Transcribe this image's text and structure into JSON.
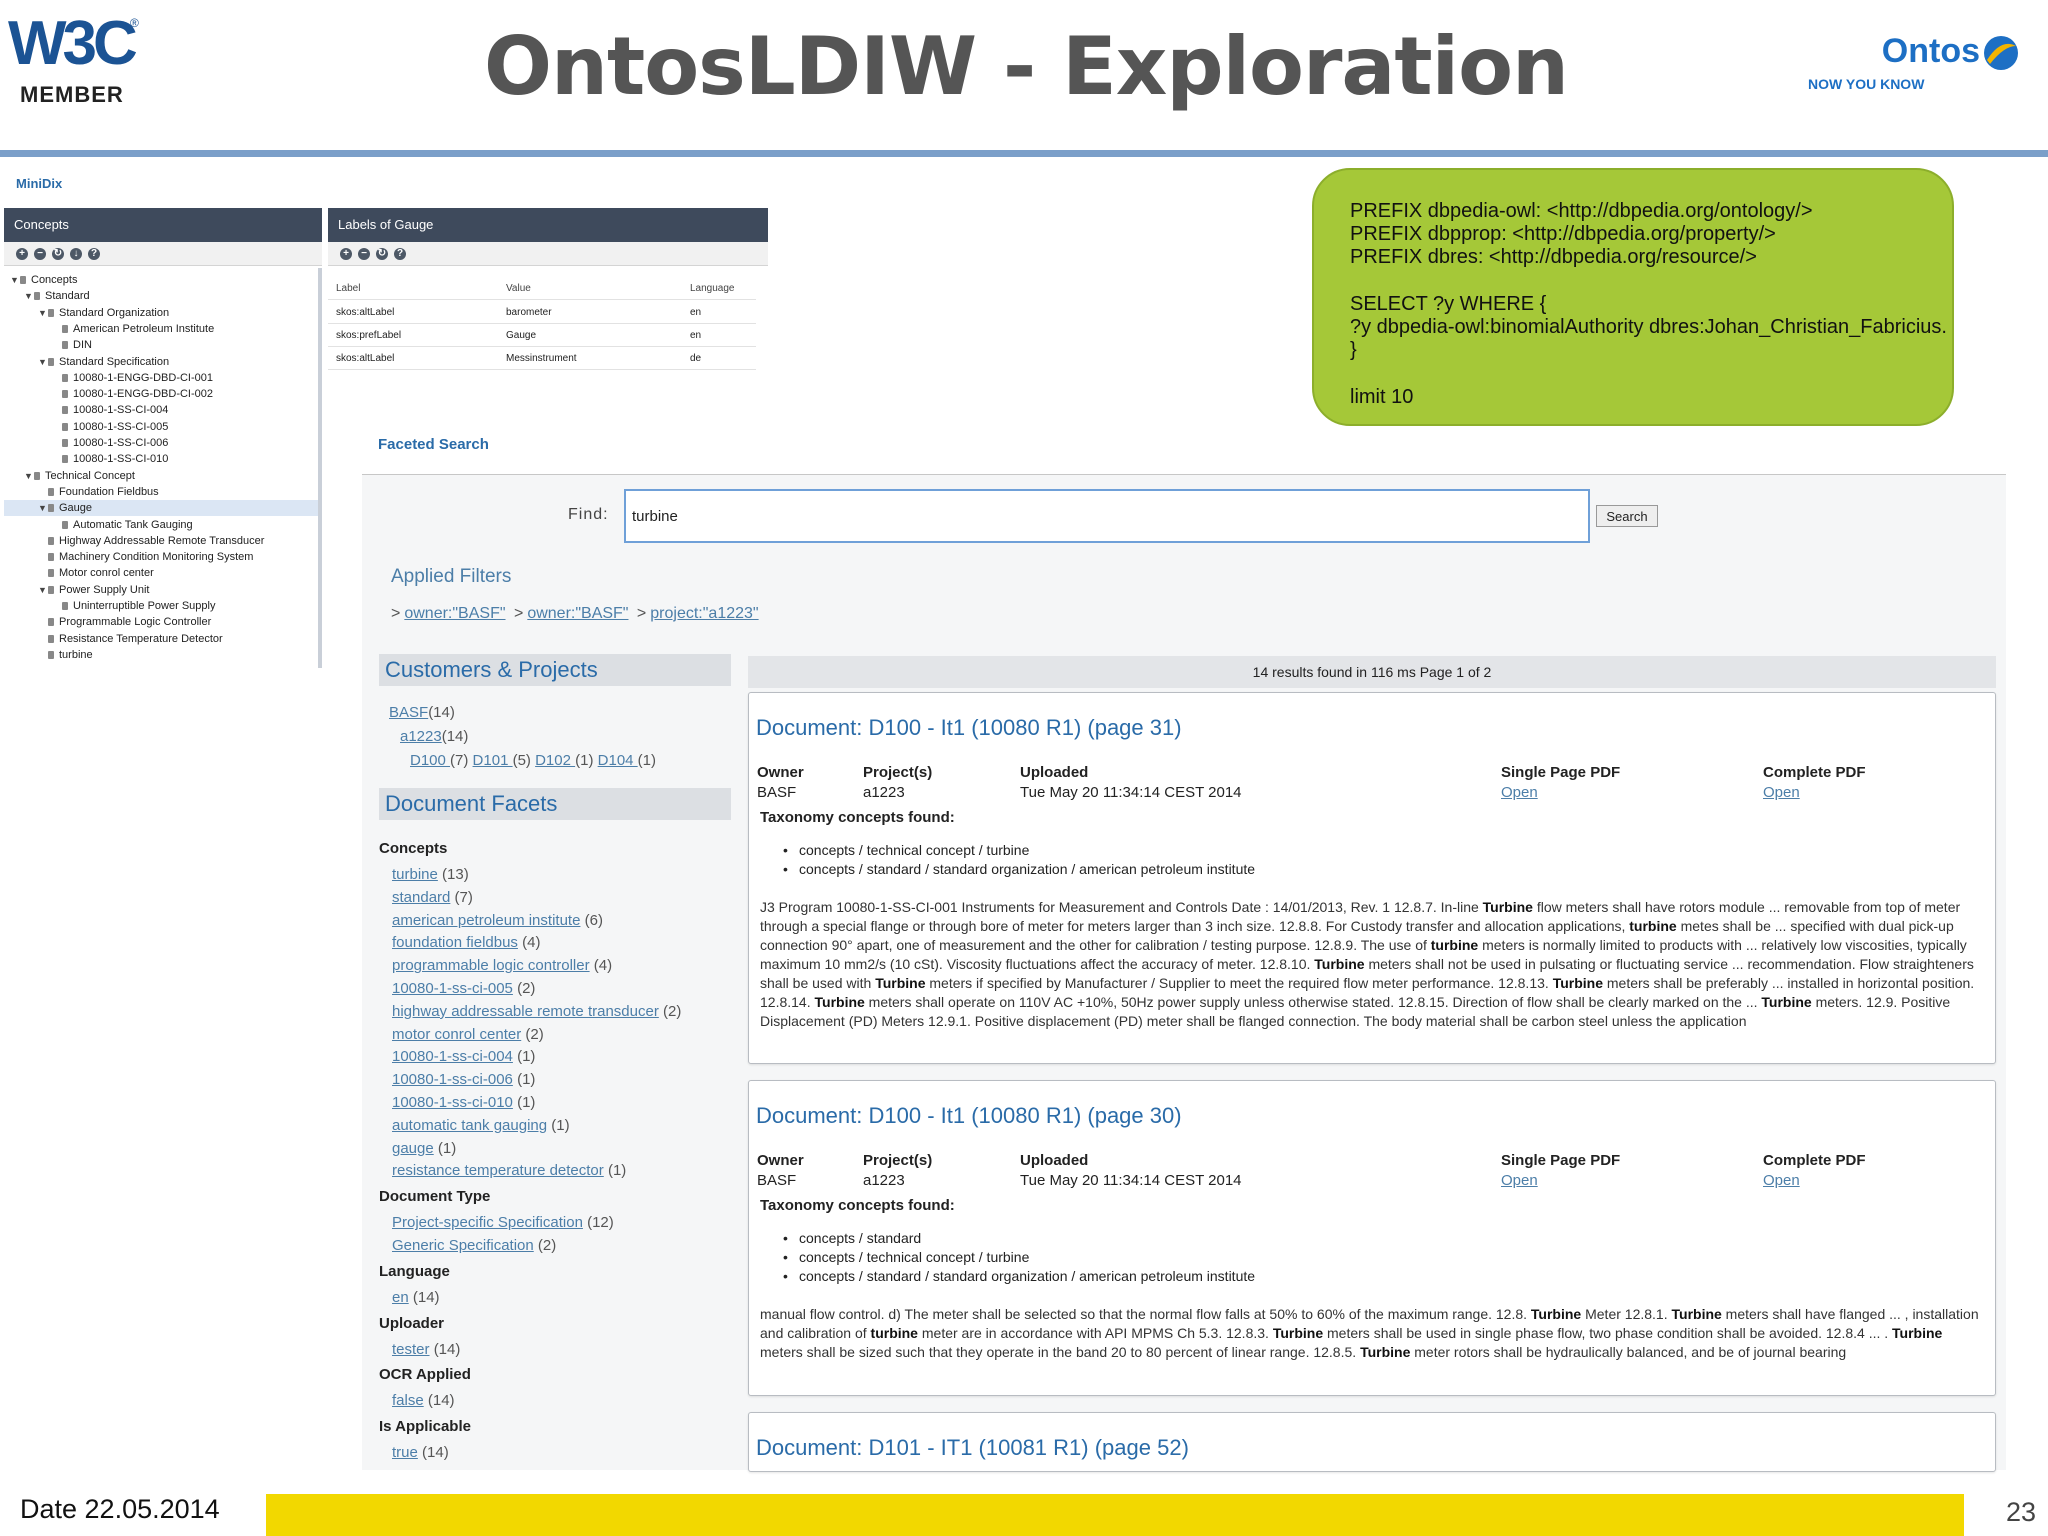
{
  "header": {
    "w3c_logo": "W3C",
    "w3c_member": "MEMBER",
    "title": "OntosLDIW - Exploration",
    "brand": "Ontos",
    "brand_tagline": "NOW YOU KNOW",
    "rule_color": "#7b9fc9"
  },
  "minidix": {
    "app_title": "MiniDix",
    "concepts_panel": {
      "title": "Concepts",
      "tools": [
        "add-icon",
        "remove-icon",
        "refresh-icon",
        "download-icon",
        "help-icon"
      ],
      "tree": [
        {
          "label": "Concepts",
          "level": 0,
          "toggle": "▼"
        },
        {
          "label": "Standard",
          "level": 1,
          "toggle": "▼"
        },
        {
          "label": "Standard Organization",
          "level": 2,
          "toggle": "▼"
        },
        {
          "label": "American Petroleum Institute",
          "level": 3,
          "toggle": ""
        },
        {
          "label": "DIN",
          "level": 3,
          "toggle": ""
        },
        {
          "label": "Standard Specification",
          "level": 2,
          "toggle": "▼"
        },
        {
          "label": "10080-1-ENGG-DBD-CI-001",
          "level": 3,
          "toggle": ""
        },
        {
          "label": "10080-1-ENGG-DBD-CI-002",
          "level": 3,
          "toggle": ""
        },
        {
          "label": "10080-1-SS-CI-004",
          "level": 3,
          "toggle": ""
        },
        {
          "label": "10080-1-SS-CI-005",
          "level": 3,
          "toggle": ""
        },
        {
          "label": "10080-1-SS-CI-006",
          "level": 3,
          "toggle": ""
        },
        {
          "label": "10080-1-SS-CI-010",
          "level": 3,
          "toggle": ""
        },
        {
          "label": "Technical Concept",
          "level": 1,
          "toggle": "▼"
        },
        {
          "label": "Foundation Fieldbus",
          "level": 2,
          "toggle": ""
        },
        {
          "label": "Gauge",
          "level": 2,
          "toggle": "▼",
          "selected": true
        },
        {
          "label": "Automatic Tank Gauging",
          "level": 3,
          "toggle": ""
        },
        {
          "label": "Highway Addressable Remote Transducer",
          "level": 2,
          "toggle": ""
        },
        {
          "label": "Machinery Condition Monitoring System",
          "level": 2,
          "toggle": ""
        },
        {
          "label": "Motor conrol center",
          "level": 2,
          "toggle": ""
        },
        {
          "label": "Power Supply Unit",
          "level": 2,
          "toggle": "▼"
        },
        {
          "label": "Uninterruptible Power Supply",
          "level": 3,
          "toggle": ""
        },
        {
          "label": "Programmable Logic Controller",
          "level": 2,
          "toggle": ""
        },
        {
          "label": "Resistance Temperature Detector",
          "level": 2,
          "toggle": ""
        },
        {
          "label": "turbine",
          "level": 2,
          "toggle": ""
        }
      ]
    },
    "labels_panel": {
      "title": "Labels of Gauge",
      "tools": [
        "add-icon",
        "remove-icon",
        "refresh-icon",
        "help-icon"
      ],
      "columns": [
        "Label",
        "Value",
        "Language"
      ],
      "rows": [
        [
          "skos:altLabel",
          "barometer",
          "en"
        ],
        [
          "skos:prefLabel",
          "Gauge",
          "en"
        ],
        [
          "skos:altLabel",
          "Messinstrument",
          "de"
        ]
      ]
    }
  },
  "sparql": {
    "lines": [
      "PREFIX dbpedia-owl: <http://dbpedia.org/ontology/>",
      "PREFIX dbpprop: <http://dbpedia.org/property/>",
      "PREFIX dbres: <http://dbpedia.org/resource/>",
      "",
      "SELECT ?y WHERE {",
      " ?y dbpedia-owl:binomialAuthority dbres:Johan_Christian_Fabricius.",
      " }",
      "",
      "limit 10"
    ],
    "color": "#a5c838"
  },
  "faceted_search": {
    "title": "Faceted Search",
    "find_label": "Find:",
    "query": "turbine",
    "search_button": "Search",
    "applied_filters_title": "Applied Filters",
    "filters": [
      "owner:\"BASF\"",
      "owner:\"BASF\"",
      "project:\"a1223\""
    ],
    "customers_projects": {
      "title": "Customers & Projects",
      "customer": {
        "name": "BASF",
        "count": "(14)"
      },
      "project": {
        "name": "a1223",
        "count": "(14)"
      },
      "documents": [
        {
          "name": "D100 ",
          "count": "(7)"
        },
        {
          "name": "D101 ",
          "count": "(5)"
        },
        {
          "name": "D102 ",
          "count": "(1)"
        },
        {
          "name": "D104 ",
          "count": "(1)"
        }
      ]
    },
    "document_facets": {
      "title": "Document Facets",
      "groups": [
        {
          "name": "Concepts",
          "items": [
            {
              "label": "turbine",
              "count": "(13)"
            },
            {
              "label": "standard",
              "count": "(7)"
            },
            {
              "label": "american petroleum institute",
              "count": "(6)"
            },
            {
              "label": "foundation fieldbus",
              "count": "(4)"
            },
            {
              "label": "programmable logic controller",
              "count": "(4)"
            },
            {
              "label": "10080-1-ss-ci-005",
              "count": "(2)"
            },
            {
              "label": "highway addressable remote transducer",
              "count": "(2)"
            },
            {
              "label": "motor conrol center",
              "count": "(2)"
            },
            {
              "label": "10080-1-ss-ci-004",
              "count": "(1)"
            },
            {
              "label": "10080-1-ss-ci-006",
              "count": "(1)"
            },
            {
              "label": "10080-1-ss-ci-010",
              "count": "(1)"
            },
            {
              "label": "automatic tank gauging",
              "count": "(1)"
            },
            {
              "label": "gauge",
              "count": "(1)"
            },
            {
              "label": "resistance temperature detector",
              "count": "(1)"
            }
          ]
        },
        {
          "name": "Document Type",
          "items": [
            {
              "label": "Project-specific Specification",
              "count": "(12)"
            },
            {
              "label": "Generic Specification",
              "count": "(2)"
            }
          ]
        },
        {
          "name": "Language",
          "items": [
            {
              "label": "en",
              "count": "(14)"
            }
          ]
        },
        {
          "name": "Uploader",
          "items": [
            {
              "label": "tester",
              "count": "(14)"
            }
          ]
        },
        {
          "name": "OCR Applied",
          "items": [
            {
              "label": "false",
              "count": "(14)"
            }
          ]
        },
        {
          "name": "Is Applicable",
          "items": [
            {
              "label": "true",
              "count": "(14)"
            }
          ]
        }
      ]
    },
    "results_summary": "14 results found in 116 ms Page 1 of 2",
    "meta_labels": {
      "owner": "Owner",
      "projects": "Project(s)",
      "uploaded": "Uploaded",
      "single_pdf": "Single Page PDF",
      "complete_pdf": "Complete PDF",
      "open": "Open",
      "taxonomy": "Taxonomy concepts found:"
    },
    "results": [
      {
        "title": "Document: D100 - It1 (10080 R1) (page 31)",
        "owner": "BASF",
        "project": "a1223",
        "uploaded": "Tue May 20 11:34:14 CEST 2014",
        "concepts": [
          "concepts / technical concept / turbine",
          "concepts / standard / standard organization / american petroleum institute"
        ],
        "snippet": [
          {
            "t": "J3 Program 10080-1-SS-CI-001 Instruments for Measurement and Controls Date : 14/01/2013, Rev. 1 12.8.7. In-line "
          },
          {
            "t": "Turbine",
            "b": true
          },
          {
            "t": " flow meters shall have rotors module ... removable from top of meter through a special flange or through bore of meter for meters larger than 3 inch size. 12.8.8. For Custody transfer and allocation applications, "
          },
          {
            "t": "turbine",
            "b": true
          },
          {
            "t": " metes shall be ... specified with dual pick-up connection 90° apart, one of measurement and the other for calibration / testing purpose. 12.8.9. The use of "
          },
          {
            "t": "turbine",
            "b": true
          },
          {
            "t": " meters is normally limited to products with ... relatively low viscosities, typically maximum 10 mm2/s (10 cSt). Viscosity fluctuations affect the accuracy of meter. 12.8.10. "
          },
          {
            "t": "Turbine",
            "b": true
          },
          {
            "t": " meters shall not be used in pulsating or fluctuating service ... recommendation. Flow straighteners shall be used with "
          },
          {
            "t": "Turbine",
            "b": true
          },
          {
            "t": " meters if specified by Manufacturer / Supplier to meet the required flow meter performance. 12.8.13. "
          },
          {
            "t": "Turbine",
            "b": true
          },
          {
            "t": " meters shall be preferably ... installed in horizontal position. 12.8.14. "
          },
          {
            "t": "Turbine",
            "b": true
          },
          {
            "t": " meters shall operate on 110V AC +10%, 50Hz power supply unless otherwise stated. 12.8.15. Direction of flow shall be clearly marked on the ... "
          },
          {
            "t": "Turbine",
            "b": true
          },
          {
            "t": " meters. 12.9. Positive Displacement (PD) Meters 12.9.1. Positive displacement (PD) meter shall be flanged connection. The body material shall be carbon steel unless the application"
          }
        ]
      },
      {
        "title": "Document: D100 - It1 (10080 R1) (page 30)",
        "owner": "BASF",
        "project": "a1223",
        "uploaded": "Tue May 20 11:34:14 CEST 2014",
        "concepts": [
          "concepts / standard",
          "concepts / technical concept / turbine",
          "concepts / standard / standard organization / american petroleum institute"
        ],
        "snippet": [
          {
            "t": "manual flow control. d) The meter shall be selected so that the normal flow falls at 50% to 60% of the maximum range. 12.8. "
          },
          {
            "t": "Turbine",
            "b": true
          },
          {
            "t": " Meter 12.8.1. "
          },
          {
            "t": "Turbine",
            "b": true
          },
          {
            "t": " meters shall have flanged ... , installation and calibration of "
          },
          {
            "t": "turbine",
            "b": true
          },
          {
            "t": " meter are in accordance with API MPMS Ch 5.3. 12.8.3. "
          },
          {
            "t": "Turbine",
            "b": true
          },
          {
            "t": " meters shall be used in single phase flow, two phase condition shall be avoided. 12.8.4 ... . "
          },
          {
            "t": "Turbine",
            "b": true
          },
          {
            "t": " meters shall be sized such that they operate in the band 20 to 80 percent of linear range. 12.8.5. "
          },
          {
            "t": "Turbine",
            "b": true
          },
          {
            "t": " meter rotors shall be hydraulically balanced, and be of journal bearing"
          }
        ]
      },
      {
        "title": "Document: D101 - IT1 (10081 R1) (page 52)"
      }
    ]
  },
  "footer": {
    "date": "Date 22.05.2014",
    "page_number": "23",
    "bar_color": "#f2d800"
  }
}
